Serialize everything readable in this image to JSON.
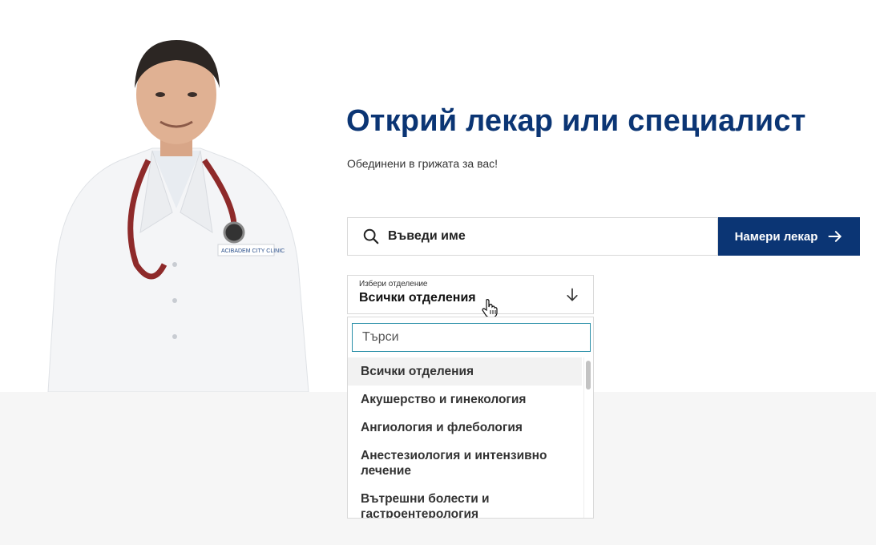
{
  "hero": {
    "title": "Открий лекар или специалист",
    "subtitle": "Обединени в грижата за вас!",
    "badge_text": "ACIBADEM CITY CLINIC"
  },
  "search": {
    "placeholder": "Въведи име",
    "icon": "search-icon"
  },
  "find_button": {
    "label": "Намери лекар",
    "icon": "arrow-right-icon"
  },
  "department_select": {
    "label": "Избери отделение",
    "value": "Всички отделения",
    "icon": "arrow-down-icon"
  },
  "dropdown": {
    "filter_placeholder": "Търси",
    "options": [
      "Всички отделения",
      "Акушерство и гинекология",
      "Ангиология и флебология",
      "Анестезиология и интензивно лечение",
      "Вътрешни болести и гастроентерология"
    ],
    "selected_index": 0
  },
  "colors": {
    "brand": "#0b3574",
    "focus": "#2a8fa8",
    "band": "#f6f6f6"
  }
}
